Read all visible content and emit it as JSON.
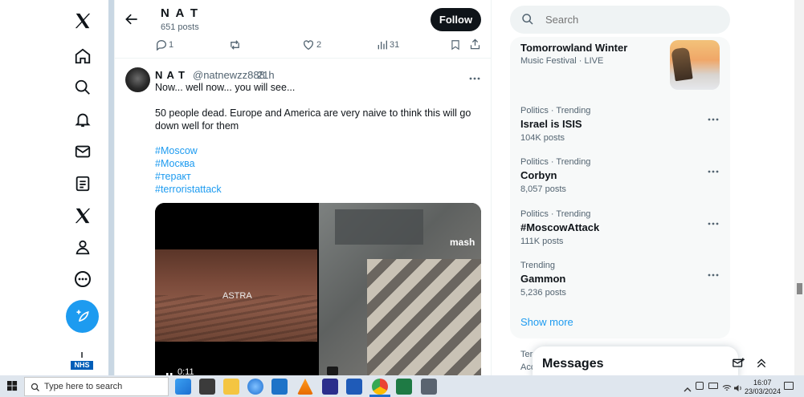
{
  "header": {
    "name": "N A T",
    "posts": "651 posts",
    "follow": "Follow"
  },
  "action_bar": {
    "replies": "1",
    "likes": "2",
    "views": "31"
  },
  "tweet": {
    "name": "N A T",
    "handle": "@natnewzz888",
    "time": "· 21h",
    "line1": "Now... well now... you will see...",
    "line2": "50 people dead. Europe and America are very naive to think this will go down well for them",
    "hashtags": [
      "#Moscow",
      "#Москва",
      "#теракт",
      "#terroristattack"
    ],
    "media_left_text": "ASTRA",
    "media_right_text": "mash",
    "video_time": "0:11"
  },
  "search": {
    "placeholder": "Search"
  },
  "trending_top": {
    "title": "Tomorrowland Winter",
    "subtitle": "Music Festival · LIVE"
  },
  "trends": [
    {
      "meta": "Politics · Trending",
      "name": "Israel is ISIS",
      "count": "104K posts"
    },
    {
      "meta": "Politics · Trending",
      "name": "Corbyn",
      "count": "8,057 posts"
    },
    {
      "meta": "Politics · Trending",
      "name": "#MoscowAttack",
      "count": "111K posts"
    },
    {
      "meta": "Trending",
      "name": "Gammon",
      "count": "5,236 posts"
    }
  ],
  "show_more": "Show more",
  "footer_fragments": [
    "Ter",
    "Acc"
  ],
  "messages": {
    "title": "Messages"
  },
  "nhs_logo": {
    "top": "I",
    "bottom": "NHS"
  },
  "taskbar": {
    "search_placeholder": "Type here to search",
    "time": "16:07",
    "date": "23/03/2024"
  },
  "colors": {
    "accent": "#1d9bf0",
    "follow_bg": "#0f1419",
    "taskbar_bg": "#dfe6ee"
  }
}
